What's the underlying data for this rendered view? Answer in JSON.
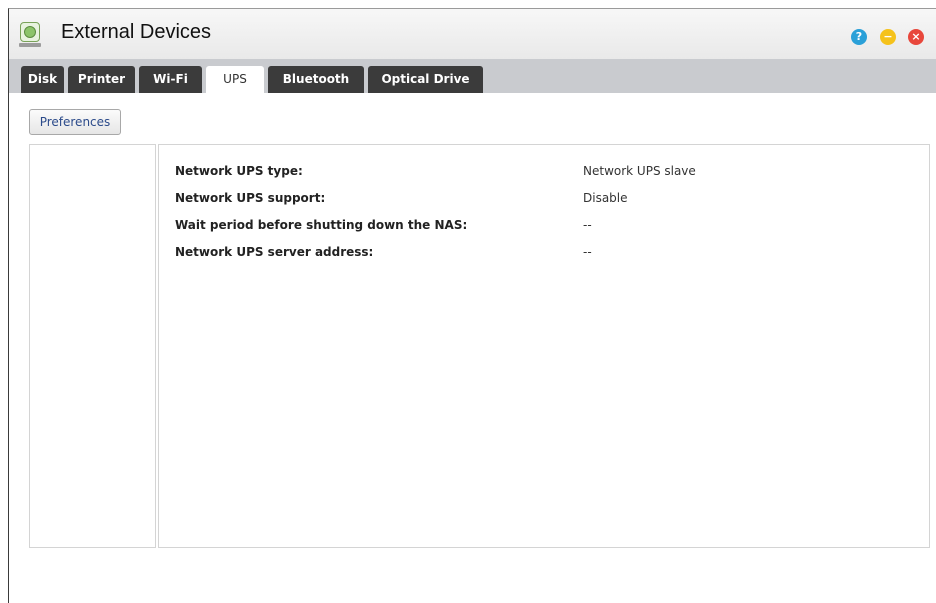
{
  "window": {
    "title": "External Devices",
    "icon": "external-devices-icon",
    "controls": {
      "help": "?",
      "minimize": "−",
      "close": "×"
    }
  },
  "tabs": [
    {
      "label": "Disk",
      "active": false
    },
    {
      "label": "Printer",
      "active": false
    },
    {
      "label": "Wi-Fi",
      "active": false
    },
    {
      "label": "UPS",
      "active": true
    },
    {
      "label": "Bluetooth",
      "active": false
    },
    {
      "label": "Optical Drive",
      "active": false
    }
  ],
  "toolbar": {
    "preferences_label": "Preferences"
  },
  "ups_info": [
    {
      "label": "Network UPS type:",
      "value": "Network UPS slave"
    },
    {
      "label": "Network UPS support:",
      "value": "Disable"
    },
    {
      "label": "Wait period before shutting down the NAS:",
      "value": "--"
    },
    {
      "label": "Network UPS server address:",
      "value": "--"
    }
  ],
  "colors": {
    "tab_bg": "#3b3b3b",
    "tab_active_bg": "#ffffff",
    "tabbar_bg": "#c9cbcf",
    "help": "#2aa0d8",
    "minimize": "#f5c21b",
    "close": "#e8473b",
    "link_text": "#2b4a8a"
  }
}
